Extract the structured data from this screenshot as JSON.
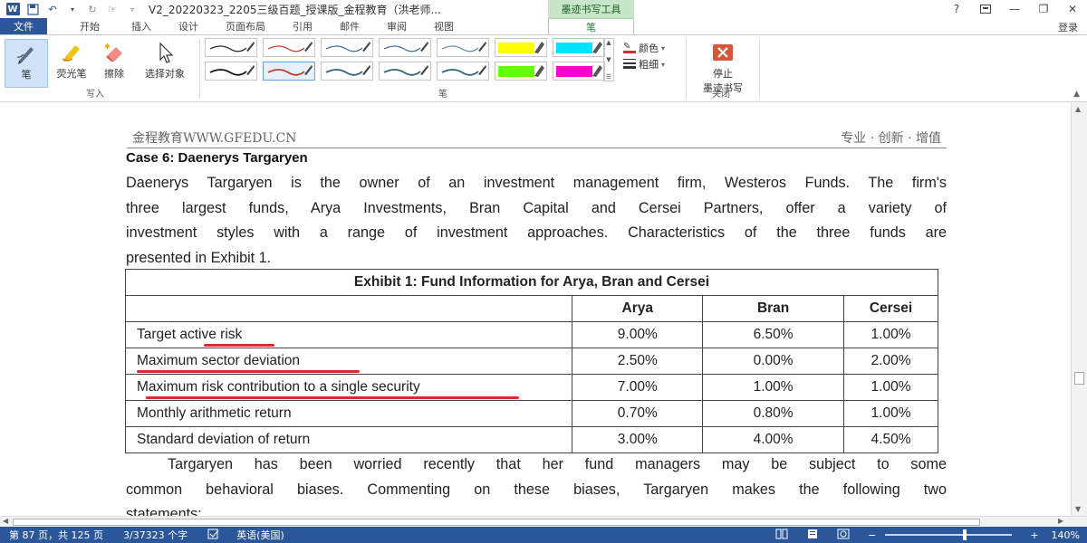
{
  "titlebar": {
    "title": "V2_20220323_2205三级百题_授课版_金程教育（洪老师...",
    "ink_tools_header": "墨迹书写工具",
    "help": "?",
    "minimize": "—",
    "restore": "❐",
    "close": "✕"
  },
  "tabs": {
    "file": "文件",
    "items": [
      "开始",
      "插入",
      "设计",
      "页面布局",
      "引用",
      "邮件",
      "审阅",
      "视图"
    ],
    "active": "笔",
    "signin": "登录"
  },
  "ribbon": {
    "write_group": {
      "label": "写入",
      "pen": "笔",
      "highlighter": "荧光笔",
      "eraser": "擦除",
      "select": "选择对象"
    },
    "pens_group": {
      "label": "笔",
      "color": "颜色",
      "thickness": "粗细",
      "swatches_row1": [
        "#222222",
        "#c0392b",
        "#3b6e8f",
        "#3b6e8f",
        "#5b8aa6",
        "#ffff00",
        "#00e5ff"
      ],
      "swatches_row2": [
        "#111111",
        "#c0392b",
        "#2d5f7a",
        "#2d5f7a",
        "#2d5f7a",
        "#66ff00",
        "#ff00cc"
      ]
    },
    "close_group": {
      "label": "关闭",
      "stop_line1": "停止",
      "stop_line2": "墨迹书写"
    }
  },
  "document": {
    "header_left": "金程教育WWW.GFEDU.CN",
    "header_right": "专业 · 创新 · 增值",
    "case_title": "Case 6: Daenerys Targaryen",
    "para1_lines": [
      "Daenerys Targaryen is the owner of an investment management firm, Westeros Funds. The firm's",
      "three largest funds, Arya Investments, Bran Capital and Cersei Partners, offer a variety of",
      "investment styles with a range of investment approaches. Characteristics of the three funds are",
      "presented in Exhibit 1."
    ],
    "exhibit": {
      "caption": "Exhibit 1: Fund Information for Arya, Bran and Cersei",
      "columns": [
        "",
        "Arya",
        "Bran",
        "Cersei"
      ],
      "rows": [
        {
          "label": "Target active risk",
          "arya": "9.00%",
          "bran": "6.50%",
          "cersei": "1.00%"
        },
        {
          "label": "Maximum sector deviation",
          "arya": "2.50%",
          "bran": "0.00%",
          "cersei": "2.00%"
        },
        {
          "label": "Maximum risk contribution to a single security",
          "arya": "7.00%",
          "bran": "1.00%",
          "cersei": "1.00%"
        },
        {
          "label": "Monthly arithmetic return",
          "arya": "0.70%",
          "bran": "0.80%",
          "cersei": "1.00%"
        },
        {
          "label": "Standard deviation of return",
          "arya": "3.00%",
          "bran": "4.00%",
          "cersei": "4.50%"
        }
      ]
    },
    "para2_lines": [
      "Targaryen has been worried recently that her fund managers may be subject to some",
      "common behavioral biases. Commenting on these biases, Targaryen makes the following two",
      "statements:"
    ]
  },
  "status": {
    "page": "第 87 页，共 125 页",
    "words": "3/37323 个字",
    "language": "英语(美国)",
    "zoom": "140%",
    "zoom_minus": "−",
    "zoom_plus": "+"
  },
  "colors": {
    "accent": "#2b579a",
    "ink_tab": "#c8e6c9",
    "underline": "#d32f2f"
  }
}
